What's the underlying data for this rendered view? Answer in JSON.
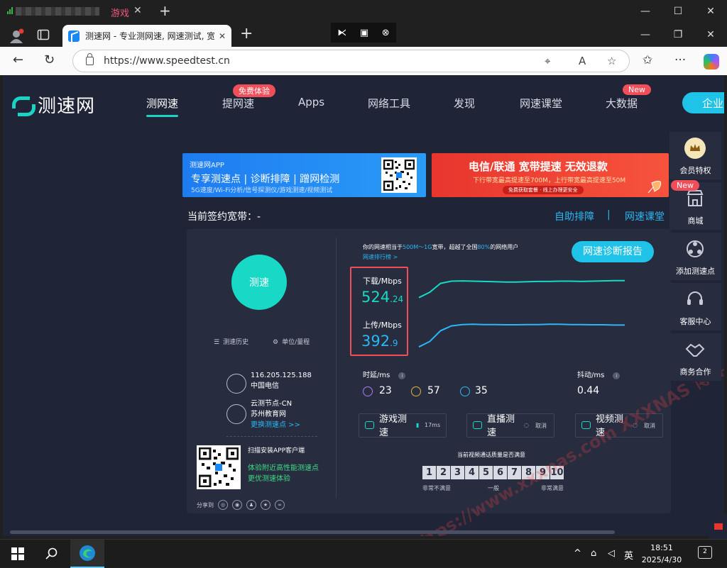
{
  "os": {
    "game_tab_label": "游戏"
  },
  "browser": {
    "tab_title": "测速网 - 专业测网速, 网速测试, 宽",
    "url": "https://www.speedtest.cn"
  },
  "site": {
    "logo_text": "测速网",
    "nav": [
      {
        "label": "测网速"
      },
      {
        "label": "提网速",
        "badge": "免费体验"
      },
      {
        "label": "Apps"
      },
      {
        "label": "网络工具"
      },
      {
        "label": "发现"
      },
      {
        "label": "网速课堂"
      },
      {
        "label": "大数据",
        "badge": "New"
      }
    ],
    "enterprise_label": "企业"
  },
  "banners": {
    "app": {
      "title": "测速网APP",
      "headline": "专享测速点 | 诊断排障 | 蹭网检测",
      "sub": "5G速度/Wi-Fi分析/信号探测仪/游戏测速/视频测试"
    },
    "promo": {
      "headline": "电信/联通 宽带提速 无效退款",
      "sub": "下行带宽最高提速至700M，上行带宽最高提速至50M",
      "cta": "免费获取套餐 · 线上办理更安全"
    }
  },
  "contract": {
    "label": "当前签约宽带：",
    "value": "-"
  },
  "toplinks": {
    "self_check": "自助排障",
    "divider": "|",
    "classroom": "网速课堂"
  },
  "tester": {
    "start_label": "测速",
    "history_label": "测速历史",
    "unit_label": "单位/量程",
    "ip": "116.205.125.188",
    "isp": "中国电信",
    "node_name": "云测节点-CN",
    "node_org": "苏州教育网",
    "change_node": "更换测速点 >>",
    "qr_title": "扫描安装APP客户端",
    "qr_line1": "体验附近高性能测速点",
    "qr_line2": "更优测速体验",
    "share_label": "分享到"
  },
  "result": {
    "headline_pre": "你的网速相当于",
    "headline_band": "500M～1G",
    "headline_mid": "宽带，超越了全国",
    "headline_pct": "80%",
    "headline_post": "的网络用户",
    "rank_link": "网速排行榜 >",
    "diagnose_btn": "网速诊断报告",
    "download_label": "下载/Mbps",
    "download_int": "524",
    "download_dec": ".24",
    "upload_label": "上传/Mbps",
    "upload_int": "392",
    "upload_dec": ".9",
    "latency_label": "时延/ms",
    "latency_ping": "23",
    "latency_down": "57",
    "latency_up": "35",
    "jitter_label": "抖动/ms",
    "jitter_value": "0.44",
    "game_test": "游戏测速",
    "game_ping": "17ms",
    "live_test": "直播测速",
    "video_test": "视频测速",
    "cancel_label": "取消",
    "quality_question": "当前视频通话质量是否满意",
    "scale": [
      "1",
      "2",
      "3",
      "4",
      "5",
      "6",
      "7",
      "8",
      "9",
      "10"
    ],
    "scale_low": "非常不满意",
    "scale_mid": "一般",
    "scale_high": "非常满意"
  },
  "sidebar": [
    {
      "label": "会员特权",
      "icon": "crown-icon"
    },
    {
      "label": "商城",
      "icon": "shop-icon",
      "badge": "New"
    },
    {
      "label": "添加测速点",
      "icon": "network-icon"
    },
    {
      "label": "客服中心",
      "icon": "headset-icon"
    },
    {
      "label": "商务合作",
      "icon": "handshake-icon"
    }
  ],
  "watermark": "https://www.xxxnas.com  XXXNAS 博客",
  "taskbar": {
    "ime": "英",
    "time": "18:51",
    "date": "2025/4/30",
    "notifications": "2"
  },
  "colors": {
    "accent_teal": "#17d9c6",
    "accent_blue": "#2bb7f3",
    "highlight_red": "#f04e59",
    "page_bg": "#1f2436"
  },
  "chart_data": {
    "type": "line",
    "title": "",
    "series": [
      {
        "values": [
          0.35,
          0.55,
          0.88,
          0.96,
          0.97,
          0.96,
          0.95,
          0.94,
          0.93,
          0.93,
          0.94,
          0.95,
          0.95,
          0.96,
          0.96,
          0.95,
          0.96,
          0.97,
          0.98,
          0.98
        ]
      },
      {
        "values": [
          0.1,
          0.3,
          0.7,
          0.88,
          0.93,
          0.94,
          0.93,
          0.93,
          0.92,
          0.92,
          0.93,
          0.93,
          0.94,
          0.94,
          0.93,
          0.93,
          0.92,
          0.92,
          0.91,
          0.91
        ]
      }
    ]
  }
}
